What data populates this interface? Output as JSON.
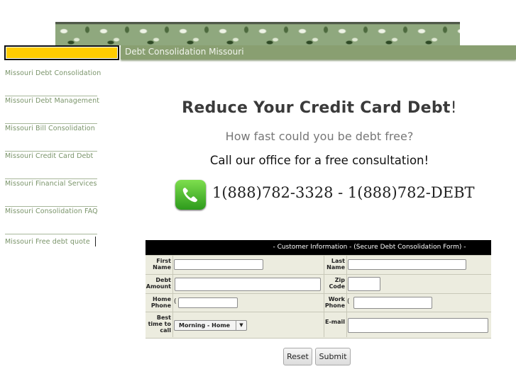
{
  "header": {
    "title": "Debt Consolidation Missouri"
  },
  "sidebar": {
    "items": [
      {
        "label": "Missouri Debt Consolidation"
      },
      {
        "label": "Missouri Debt Management"
      },
      {
        "label": "Missouri Bill Consolidation"
      },
      {
        "label": "Missouri Credit Card Debt"
      },
      {
        "label": "Missouri Financial Services"
      },
      {
        "label": "Missouri Consolidation FAQ"
      },
      {
        "label": "Missouri Free debt quote"
      }
    ]
  },
  "main": {
    "headline": "Reduce Your Credit Card Debt",
    "headline_mark": "!",
    "subheading": "How fast could you be debt free?",
    "call_text": "Call our office for a free consultation!",
    "phone_text": "1(888)782-3328 - 1(888)782-DEBT",
    "phone_icon": "phone-icon"
  },
  "form": {
    "title": "- Customer Information - (Secure Debt Consolidation Form) -",
    "first_name_label": "First Name",
    "last_name_label": "Last Name",
    "debt_amount_label": "Debt Amount",
    "zip_code_label": "Zip Code",
    "home_phone_label": "Home Phone",
    "work_phone_label": "Work Phone",
    "best_time_label": "Best time to call",
    "email_label": "E-mail",
    "paren": "(",
    "best_time_value": "Morning - Home",
    "reset_label": "Reset",
    "submit_label": "Submit"
  },
  "colors": {
    "accent_yellow": "#ffcc00",
    "header_green": "#899f71",
    "nav_text": "#7a946a"
  }
}
